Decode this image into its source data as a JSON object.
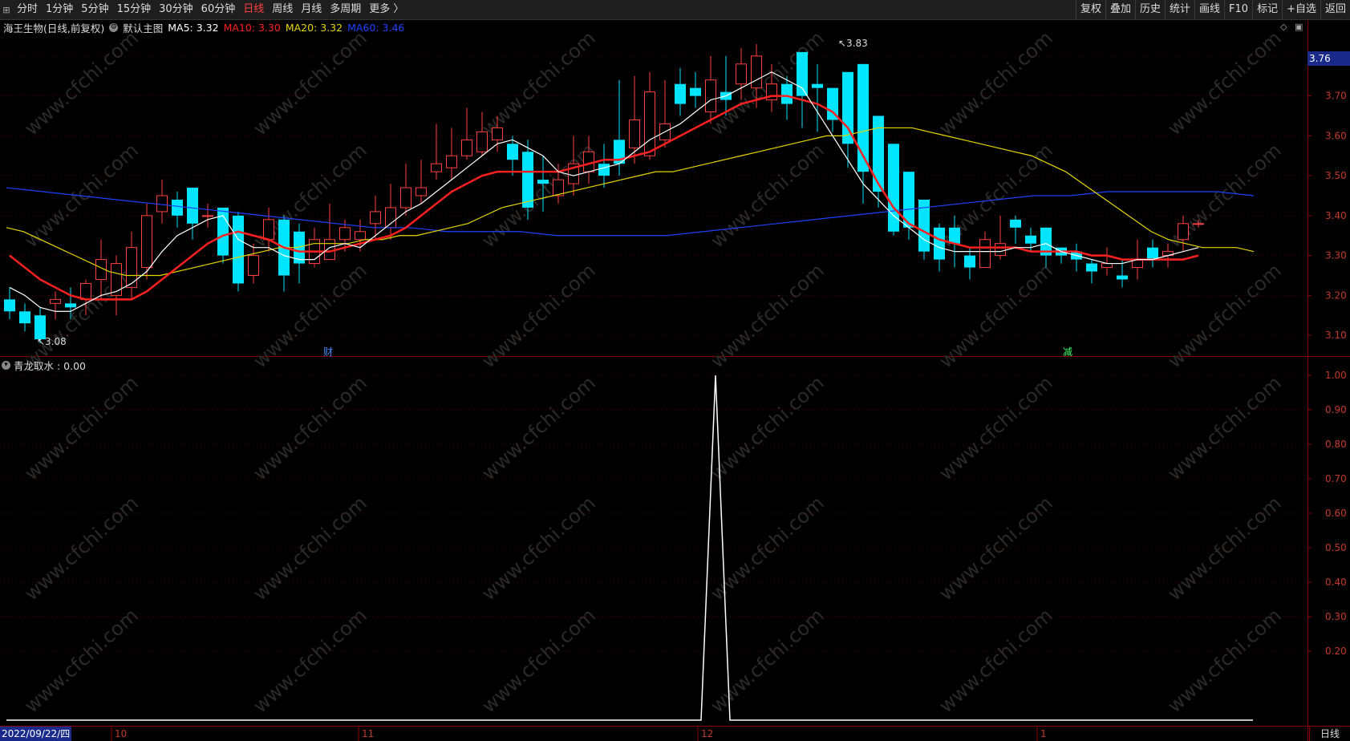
{
  "toolbar": {
    "first_icon": "menu-icon",
    "periods": [
      "分时",
      "1分钟",
      "5分钟",
      "15分钟",
      "30分钟",
      "60分钟",
      "日线",
      "周线",
      "月线",
      "多周期",
      "更多 〉"
    ],
    "active": "日线",
    "right": [
      "复权",
      "叠加",
      "历史",
      "统计",
      "画线",
      "F10",
      "标记",
      "+自选",
      "返回"
    ]
  },
  "info": {
    "stock": "海王生物(日线,前复权)",
    "main": "默认主图",
    "ma5": "MA5: 3.32",
    "ma10": "MA10: 3.30",
    "ma20": "MA20: 3.32",
    "ma60": "MA60: 3.46"
  },
  "colors": {
    "ma5": "#ffffff",
    "ma10": "#ff2020",
    "ma20": "#e6d600",
    "ma60": "#2040ff",
    "up": "#ff4040",
    "down": "#00e5ff",
    "axis": "#8b0000"
  },
  "price_axis": [
    "3.80",
    "3.70",
    "3.60",
    "3.50",
    "3.40",
    "3.30",
    "3.20",
    "3.10"
  ],
  "current_price": "3.76",
  "high_label": "3.83",
  "low_label": "3.08",
  "events": [
    "财",
    "减"
  ],
  "indicator": {
    "title": "青龙取水 : 0.00",
    "axis": [
      "1.00",
      "0.90",
      "0.80",
      "0.70",
      "0.60",
      "0.50",
      "0.40",
      "0.30",
      "0.20"
    ]
  },
  "dates": {
    "start": "2022/09/22/四",
    "marks": [
      "10",
      "11",
      "12",
      "1"
    ]
  },
  "period_label": "日线",
  "watermark": "www.cfchi.com",
  "chart_data": {
    "type": "candlestick",
    "open": [
      3.19,
      3.16,
      3.15,
      3.18,
      3.18,
      3.19,
      3.24,
      3.2,
      3.22,
      3.27,
      3.41,
      3.44,
      3.47,
      3.4,
      3.42,
      3.4,
      3.25,
      3.34,
      3.39,
      3.36,
      3.28,
      3.29,
      3.34,
      3.34,
      3.38,
      3.37,
      3.42,
      3.45,
      3.51,
      3.52,
      3.55,
      3.56,
      3.59,
      3.58,
      3.56,
      3.49,
      3.45,
      3.48,
      3.51,
      3.53,
      3.59,
      3.57,
      3.55,
      3.59,
      3.73,
      3.72,
      3.66,
      3.71,
      3.73,
      3.72,
      3.69,
      3.73,
      3.81,
      3.73,
      3.72,
      3.76,
      3.78,
      3.65,
      3.58,
      3.51,
      3.44,
      3.37,
      3.37,
      3.3,
      3.27,
      3.3,
      3.39,
      3.35,
      3.37,
      3.32,
      3.31,
      3.28,
      3.27,
      3.25,
      3.27,
      3.32,
      3.3,
      3.34,
      3.38
    ],
    "close": [
      3.16,
      3.13,
      3.09,
      3.19,
      3.17,
      3.23,
      3.29,
      3.28,
      3.32,
      3.4,
      3.45,
      3.4,
      3.38,
      3.4,
      3.3,
      3.23,
      3.3,
      3.39,
      3.25,
      3.28,
      3.34,
      3.34,
      3.37,
      3.36,
      3.41,
      3.42,
      3.47,
      3.47,
      3.53,
      3.55,
      3.59,
      3.61,
      3.62,
      3.54,
      3.42,
      3.48,
      3.49,
      3.53,
      3.56,
      3.5,
      3.53,
      3.64,
      3.71,
      3.63,
      3.68,
      3.7,
      3.74,
      3.69,
      3.78,
      3.8,
      3.73,
      3.68,
      3.7,
      3.72,
      3.64,
      3.58,
      3.51,
      3.46,
      3.36,
      3.37,
      3.31,
      3.29,
      3.33,
      3.27,
      3.34,
      3.33,
      3.37,
      3.33,
      3.3,
      3.3,
      3.29,
      3.26,
      3.28,
      3.24,
      3.29,
      3.29,
      3.31,
      3.38,
      3.38
    ],
    "high": [
      3.22,
      3.18,
      3.17,
      3.21,
      3.22,
      3.24,
      3.34,
      3.3,
      3.36,
      3.43,
      3.49,
      3.46,
      3.47,
      3.43,
      3.42,
      3.41,
      3.33,
      3.42,
      3.4,
      3.38,
      3.37,
      3.43,
      3.39,
      3.39,
      3.45,
      3.48,
      3.53,
      3.54,
      3.63,
      3.62,
      3.67,
      3.66,
      3.65,
      3.6,
      3.59,
      3.55,
      3.53,
      3.6,
      3.6,
      3.58,
      3.74,
      3.75,
      3.76,
      3.74,
      3.77,
      3.76,
      3.8,
      3.8,
      3.82,
      3.83,
      3.78,
      3.75,
      3.8,
      3.78,
      3.7,
      3.65,
      3.58,
      3.54,
      3.41,
      3.4,
      3.36,
      3.38,
      3.4,
      3.32,
      3.36,
      3.4,
      3.4,
      3.37,
      3.33,
      3.32,
      3.33,
      3.29,
      3.32,
      3.29,
      3.34,
      3.34,
      3.33,
      3.4,
      3.39
    ],
    "low": [
      3.14,
      3.11,
      3.08,
      3.14,
      3.14,
      3.15,
      3.19,
      3.15,
      3.19,
      3.24,
      3.38,
      3.37,
      3.34,
      3.37,
      3.28,
      3.21,
      3.23,
      3.31,
      3.21,
      3.23,
      3.27,
      3.29,
      3.31,
      3.31,
      3.34,
      3.34,
      3.4,
      3.43,
      3.49,
      3.49,
      3.54,
      3.55,
      3.56,
      3.5,
      3.39,
      3.41,
      3.43,
      3.45,
      3.48,
      3.47,
      3.5,
      3.53,
      3.54,
      3.57,
      3.65,
      3.67,
      3.63,
      3.65,
      3.69,
      3.67,
      3.66,
      3.64,
      3.62,
      3.61,
      3.61,
      3.52,
      3.43,
      3.42,
      3.35,
      3.34,
      3.29,
      3.26,
      3.27,
      3.24,
      3.29,
      3.29,
      3.33,
      3.31,
      3.27,
      3.28,
      3.26,
      3.23,
      3.25,
      3.22,
      3.24,
      3.27,
      3.27,
      3.31,
      3.37
    ],
    "ma5": [
      3.22,
      3.2,
      3.17,
      3.16,
      3.16,
      3.18,
      3.2,
      3.21,
      3.23,
      3.26,
      3.31,
      3.35,
      3.37,
      3.39,
      3.4,
      3.34,
      3.32,
      3.32,
      3.3,
      3.29,
      3.29,
      3.32,
      3.33,
      3.32,
      3.35,
      3.38,
      3.41,
      3.43,
      3.46,
      3.49,
      3.52,
      3.55,
      3.58,
      3.59,
      3.57,
      3.55,
      3.51,
      3.5,
      3.51,
      3.52,
      3.53,
      3.56,
      3.59,
      3.61,
      3.63,
      3.66,
      3.69,
      3.7,
      3.72,
      3.74,
      3.76,
      3.74,
      3.72,
      3.66,
      3.6,
      3.54,
      3.48,
      3.44,
      3.4,
      3.37,
      3.34,
      3.32,
      3.31,
      3.31,
      3.31,
      3.31,
      3.32,
      3.32,
      3.33,
      3.31,
      3.3,
      3.29,
      3.28,
      3.28,
      3.29,
      3.29,
      3.3,
      3.31,
      3.32
    ],
    "ma10": [
      3.3,
      3.27,
      3.24,
      3.22,
      3.2,
      3.19,
      3.19,
      3.19,
      3.19,
      3.21,
      3.24,
      3.27,
      3.3,
      3.33,
      3.35,
      3.36,
      3.35,
      3.34,
      3.32,
      3.31,
      3.31,
      3.31,
      3.32,
      3.33,
      3.34,
      3.35,
      3.37,
      3.4,
      3.43,
      3.46,
      3.48,
      3.5,
      3.51,
      3.51,
      3.51,
      3.51,
      3.51,
      3.52,
      3.53,
      3.54,
      3.54,
      3.55,
      3.56,
      3.58,
      3.6,
      3.62,
      3.64,
      3.66,
      3.68,
      3.69,
      3.7,
      3.7,
      3.69,
      3.68,
      3.66,
      3.62,
      3.55,
      3.48,
      3.42,
      3.38,
      3.36,
      3.34,
      3.33,
      3.32,
      3.32,
      3.32,
      3.32,
      3.31,
      3.31,
      3.31,
      3.31,
      3.3,
      3.3,
      3.29,
      3.29,
      3.29,
      3.29,
      3.29,
      3.3
    ],
    "ma20": [
      3.37,
      3.36,
      3.34,
      3.32,
      3.3,
      3.28,
      3.26,
      3.25,
      3.25,
      3.25,
      3.26,
      3.27,
      3.28,
      3.29,
      3.3,
      3.31,
      3.32,
      3.32,
      3.33,
      3.33,
      3.33,
      3.34,
      3.34,
      3.35,
      3.35,
      3.36,
      3.37,
      3.38,
      3.4,
      3.42,
      3.43,
      3.44,
      3.45,
      3.46,
      3.47,
      3.48,
      3.49,
      3.5,
      3.51,
      3.51,
      3.52,
      3.53,
      3.54,
      3.55,
      3.56,
      3.57,
      3.58,
      3.59,
      3.6,
      3.6,
      3.61,
      3.62,
      3.62,
      3.62,
      3.61,
      3.6,
      3.59,
      3.58,
      3.57,
      3.56,
      3.55,
      3.53,
      3.51,
      3.48,
      3.45,
      3.42,
      3.39,
      3.36,
      3.34,
      3.33,
      3.32,
      3.32,
      3.32,
      3.31
    ],
    "ma60": [
      3.47,
      3.46,
      3.45,
      3.44,
      3.43,
      3.42,
      3.41,
      3.4,
      3.39,
      3.38,
      3.37,
      3.37,
      3.36,
      3.36,
      3.36,
      3.35,
      3.35,
      3.35,
      3.35,
      3.36,
      3.37,
      3.38,
      3.39,
      3.4,
      3.41,
      3.42,
      3.43,
      3.44,
      3.45,
      3.45,
      3.46,
      3.46,
      3.46,
      3.46,
      3.45
    ],
    "indicator_values": "0 everywhere except 1.00 at the spike in early December",
    "indicator_spike": 1.0
  }
}
